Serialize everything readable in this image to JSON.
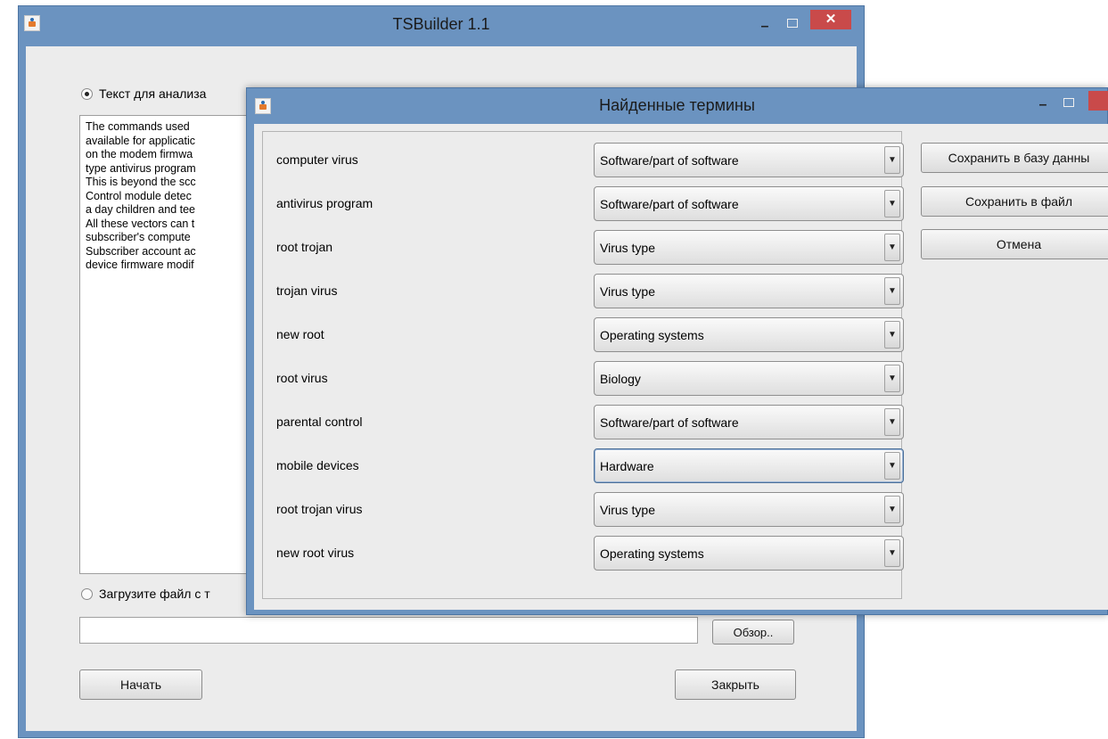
{
  "main_window": {
    "title": "TSBuilder 1.1",
    "radio_text": "Текст для анализа",
    "text_lines": [
      "The commands used",
      "available for applicatic",
      "on the modem firmwa",
      "type antivirus program",
      "This is beyond the scc",
      "Control module detec",
      "a day children and tee",
      "All these vectors can t",
      "subscriber's compute",
      "Subscriber account ac",
      "device firmware modif"
    ],
    "radio_file": "Загрузите файл с т",
    "file_path_value": "",
    "browse_label": "Обзор..",
    "start_label": "Начать",
    "close_label": "Закрыть",
    "minimize_glyph": "–",
    "close_glyph": "✕"
  },
  "dialog": {
    "title": "Найденные термины",
    "save_db_label": "Сохранить в базу данны",
    "save_file_label": "Сохранить в файл",
    "cancel_label": "Отмена",
    "minimize_glyph": "–",
    "dropdown_glyph": "▼",
    "terms": [
      {
        "term": "computer virus",
        "category": "Software/part of software"
      },
      {
        "term": "antivirus program",
        "category": "Software/part of software"
      },
      {
        "term": "root trojan",
        "category": "Virus type"
      },
      {
        "term": "trojan virus",
        "category": "Virus type"
      },
      {
        "term": "new root",
        "category": "Operating systems"
      },
      {
        "term": "root virus",
        "category": "Biology"
      },
      {
        "term": "parental control",
        "category": "Software/part of software"
      },
      {
        "term": "mobile devices",
        "category": "Hardware",
        "focused": true
      },
      {
        "term": "root trojan virus",
        "category": "Virus type"
      },
      {
        "term": "new root virus",
        "category": "Operating systems"
      }
    ]
  },
  "colors": {
    "title_bar": "#6b93c0",
    "client_bg": "#ececec",
    "close_button": "#c94a4a"
  }
}
